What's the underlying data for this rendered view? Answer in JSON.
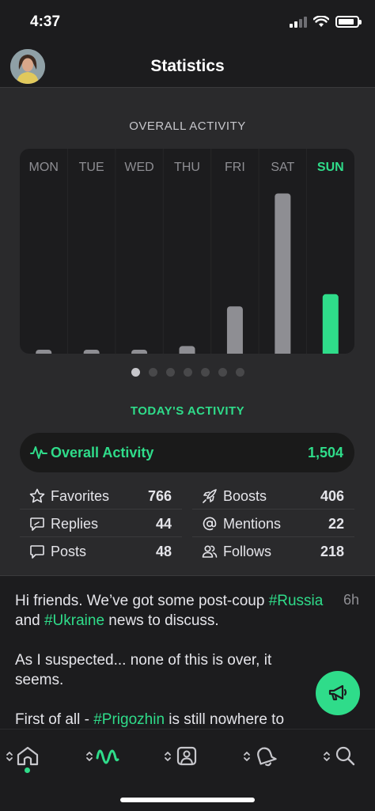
{
  "status_bar": {
    "time": "4:37"
  },
  "header": {
    "title": "Statistics",
    "avatar_icon": "user-avatar"
  },
  "overall_activity": {
    "title": "OVERALL ACTIVITY",
    "active_day_color": "#2fdc8a",
    "inactive_bar_color": "#8e8e93",
    "pages": 7,
    "active_page": 1
  },
  "chart_data": {
    "type": "bar",
    "categories": [
      "MON",
      "TUE",
      "WED",
      "THU",
      "FRI",
      "SAT",
      "SUN"
    ],
    "values": [
      5,
      2,
      2,
      10,
      62,
      210,
      78
    ],
    "highlight_category": "SUN",
    "ylim": [
      0,
      225
    ]
  },
  "today": {
    "title": "TODAY'S ACTIVITY",
    "overall_label": "Overall Activity",
    "overall_value": "1,504",
    "stats": [
      {
        "icon": "star-icon",
        "label": "Favorites",
        "value": "766"
      },
      {
        "icon": "rocket-icon",
        "label": "Boosts",
        "value": "406"
      },
      {
        "icon": "reply-icon",
        "label": "Replies",
        "value": "44"
      },
      {
        "icon": "at-icon",
        "label": "Mentions",
        "value": "22"
      },
      {
        "icon": "speech-bubble-icon",
        "label": "Posts",
        "value": "48"
      },
      {
        "icon": "people-icon",
        "label": "Follows",
        "value": "218"
      }
    ]
  },
  "post": {
    "time": "6h",
    "line1a": "Hi friends. We’ve got some post-coup ",
    "tag_russia": "#Russia",
    "and": " and ",
    "tag_ukraine": "#Ukraine",
    "line2b": " news to discuss.",
    "para2": "As I suspected... none of this is over, it seems.",
    "para3a": "First of all - ",
    "tag_prigozhin": "#Prigozhin",
    "para3b": " is still nowhere to"
  },
  "fab": {
    "icon": "megaphone-icon"
  },
  "tabs": [
    {
      "name": "home",
      "icon": "home-icon",
      "active": false
    },
    {
      "name": "activity",
      "icon": "activity-icon",
      "active": true
    },
    {
      "name": "profile",
      "icon": "profile-icon",
      "active": false
    },
    {
      "name": "notifications",
      "icon": "bell-icon",
      "active": false
    },
    {
      "name": "search",
      "icon": "search-icon",
      "active": false
    }
  ],
  "colors": {
    "accent": "#2fdc8a",
    "background": "#1c1c1e",
    "panel": "#2a2a2c"
  }
}
